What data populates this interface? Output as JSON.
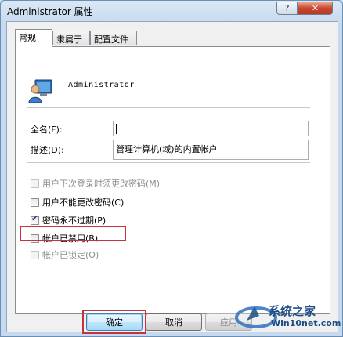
{
  "window": {
    "title": "Administrator 属性",
    "help_label": "?",
    "close_label": "✕"
  },
  "tabs": [
    {
      "label": "常规",
      "active": true
    },
    {
      "label": "隶属于",
      "active": false
    },
    {
      "label": "配置文件",
      "active": false
    }
  ],
  "general": {
    "username": "Administrator",
    "fullname": {
      "label": "全名(F):",
      "value": ""
    },
    "description": {
      "label": "描述(D):",
      "value": "管理计算机(域)的内置帐户"
    },
    "checkboxes": [
      {
        "label": "用户下次登录时须更改密码(M)",
        "checked": false,
        "enabled": false
      },
      {
        "label": "用户不能更改密码(C)",
        "checked": false,
        "enabled": true
      },
      {
        "label": "密码永不过期(P)",
        "checked": true,
        "enabled": true
      },
      {
        "label": "帐户已禁用(B)",
        "checked": false,
        "enabled": true
      },
      {
        "label": "帐户已锁定(O)",
        "checked": false,
        "enabled": false
      }
    ]
  },
  "buttons": {
    "ok": "确定",
    "cancel": "取消",
    "apply": "应用"
  },
  "watermark": {
    "text": "系统之家",
    "url": "Win10net.com"
  },
  "colors": {
    "highlight": "#c8323c",
    "titlebar": "#c6d9ee",
    "close": "#c8462e"
  }
}
